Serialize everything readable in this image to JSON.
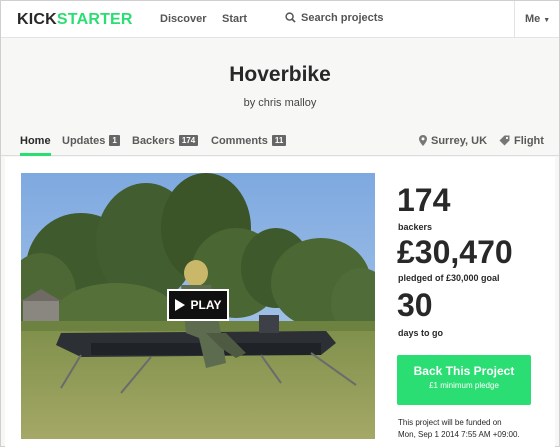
{
  "nav": {
    "logo_part1": "KICK",
    "logo_part2": "STARTER",
    "discover": "Discover",
    "start": "Start",
    "search_placeholder": "Search projects",
    "me": "Me"
  },
  "project": {
    "title": "Hoverbike",
    "creator": "by chris malloy"
  },
  "tabs": [
    {
      "label": "Home"
    },
    {
      "label": "Updates",
      "count": "1"
    },
    {
      "label": "Backers",
      "count": "174"
    },
    {
      "label": "Comments",
      "count": "11"
    }
  ],
  "meta": {
    "location": "Surrey, UK",
    "category": "Flight"
  },
  "video": {
    "play_label": "PLAY"
  },
  "stats": {
    "backers_value": "174",
    "backers_label": "backers",
    "pledged_value": "£30,470",
    "pledged_label": "pledged of £30,000 goal",
    "days_value": "30",
    "days_label": "days to go"
  },
  "cta": {
    "label": "Back This Project",
    "sub": "£1 minimum pledge"
  },
  "funding_note": {
    "line1": "This project will be funded on",
    "line2": "Mon, Sep 1 2014 7:55 AM +09:00."
  },
  "colors": {
    "brand": "#2bde73",
    "text": "#282828"
  },
  "icons": [
    "search-icon",
    "location-pin-icon",
    "tag-icon",
    "play-icon",
    "chevron-down-icon"
  ]
}
